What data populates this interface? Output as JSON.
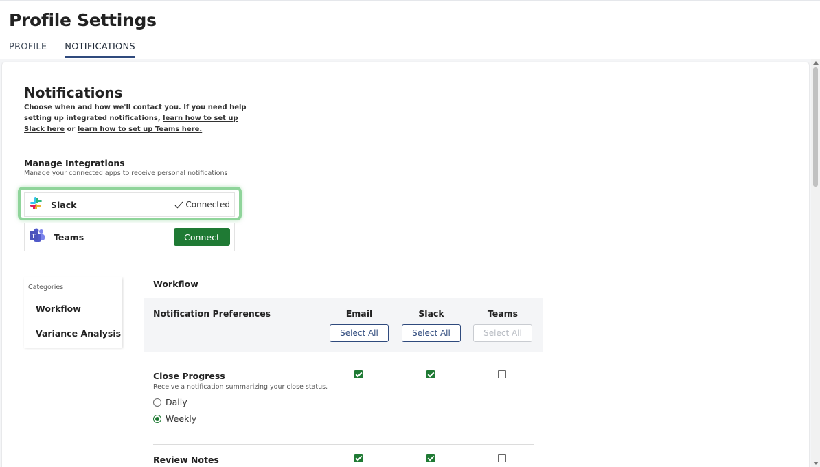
{
  "header": {
    "title": "Profile Settings",
    "tabs": [
      {
        "label": "PROFILE",
        "active": false
      },
      {
        "label": "NOTIFICATIONS",
        "active": true
      }
    ]
  },
  "notifications": {
    "title": "Notifications",
    "desc_prefix": "Choose when and how we'll contact you. If you need help setting up integrated notifications, ",
    "slack_link": "learn how to set up Slack here",
    "desc_or": " or ",
    "teams_link": "learn how to set up Teams here."
  },
  "integrations": {
    "title": "Manage Integrations",
    "subtitle": "Manage your connected apps to receive personal notifications",
    "slack": {
      "name": "Slack",
      "status": "Connected",
      "icon": "slack-icon"
    },
    "teams": {
      "name": "Teams",
      "button": "Connect",
      "icon": "teams-icon"
    }
  },
  "categories": {
    "label": "Categories",
    "items": [
      "Workflow",
      "Variance Analysis"
    ]
  },
  "workflow": {
    "title": "Workflow",
    "pref_label": "Notification Preferences",
    "columns": [
      "Email",
      "Slack",
      "Teams"
    ],
    "select_all": "Select All",
    "rows": [
      {
        "title": "Close Progress",
        "subtitle": "Receive a notification summarizing your close status.",
        "email": true,
        "slack": true,
        "teams": false,
        "frequency": [
          {
            "label": "Daily",
            "selected": false
          },
          {
            "label": "Weekly",
            "selected": true
          }
        ]
      },
      {
        "title": "Review Notes",
        "email": true,
        "slack": true,
        "teams": false
      }
    ]
  },
  "colors": {
    "accent": "#1f7a34",
    "navy": "#2f4a7d",
    "highlight": "#8fd49a"
  }
}
